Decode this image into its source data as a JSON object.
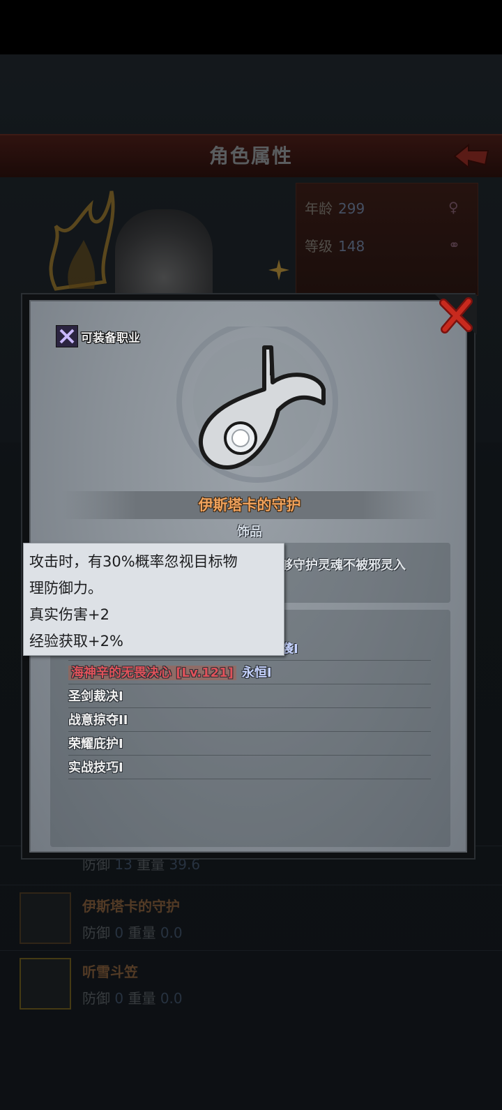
{
  "header": {
    "title": "角色属性"
  },
  "character_info": {
    "age_label": "年龄",
    "age_value": "299",
    "level_label": "等级",
    "level_value": "148"
  },
  "equipment_list": [
    {
      "name": "",
      "stat1_label": "防御",
      "stat1_value": "13",
      "stat2_label": "重量",
      "stat2_value": "39.6"
    },
    {
      "name": "伊斯塔卡的守护",
      "stat1_label": "防御",
      "stat1_value": "0",
      "stat2_label": "重量",
      "stat2_value": "0.0"
    },
    {
      "name": "听雪斗笠",
      "stat1_label": "防御",
      "stat1_value": "0",
      "stat2_label": "重量",
      "stat2_value": "0.0"
    }
  ],
  "modal": {
    "class_label": "可装备职业",
    "item_name": "伊斯塔卡的守护",
    "item_type": "饰品",
    "description": "够守护灵魂不被邪灵入",
    "skill_partial": "袭I",
    "skills": [
      {
        "red": "海神辛的无畏决心 [Lv.121]",
        "blue": "永恒I"
      },
      {
        "text": "圣剑裁决I"
      },
      {
        "text": "战意掠夺II"
      },
      {
        "text": "荣耀庇护I"
      },
      {
        "text": "实战技巧I"
      }
    ]
  },
  "tooltip": {
    "lines": [
      "攻击时，有30%概率忽视目标物",
      "理防御力。",
      "真实伤害+2",
      "经验获取+2%"
    ]
  },
  "colors": {
    "item_name": "#f0a25c",
    "skill_red": "#e0525a",
    "skill_blue": "#c6d3ff"
  }
}
